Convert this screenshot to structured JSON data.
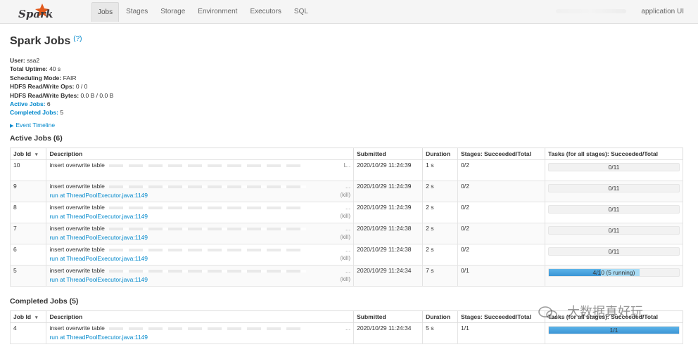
{
  "nav": {
    "tabs": [
      "Jobs",
      "Stages",
      "Storage",
      "Environment",
      "Executors",
      "SQL"
    ],
    "active_tab": "Jobs",
    "app_label": "application UI"
  },
  "page": {
    "title": "Spark Jobs",
    "help": "(?)"
  },
  "summary": {
    "user_label": "User:",
    "user": "ssa2",
    "uptime_label": "Total Uptime:",
    "uptime": "40 s",
    "mode_label": "Scheduling Mode:",
    "mode": "FAIR",
    "ops_label": "HDFS Read/Write Ops:",
    "ops": "0 / 0",
    "bytes_label": "HDFS Read/Write Bytes:",
    "bytes": "0.0 B / 0.0 B",
    "active_label": "Active Jobs:",
    "active": "6",
    "completed_label": "Completed Jobs:",
    "completed": "5"
  },
  "timeline": {
    "label": "Event Timeline"
  },
  "active_section": {
    "title": "Active Jobs (6)"
  },
  "completed_section": {
    "title": "Completed Jobs (5)"
  },
  "columns": [
    "Job Id",
    "Description",
    "Submitted",
    "Duration",
    "Stages: Succeeded/Total",
    "Tasks (for all stages): Succeeded/Total"
  ],
  "sort_indicator": "▾",
  "active_jobs": [
    {
      "id": "10",
      "desc": "insert overwrite table",
      "tail": "L..",
      "link": "",
      "kill": "",
      "submitted": "2020/10/29 11:24:39",
      "duration": "1 s",
      "stages": "0/2",
      "tasks": "0/11",
      "progress": 0,
      "running": 0
    },
    {
      "id": "9",
      "desc": "insert overwrite table",
      "tail": "...",
      "link": "run at ThreadPoolExecutor.java:1149",
      "kill": "(kill)",
      "submitted": "2020/10/29 11:24:39",
      "duration": "2 s",
      "stages": "0/2",
      "tasks": "0/11",
      "progress": 0,
      "running": 0
    },
    {
      "id": "8",
      "desc": "insert overwrite table",
      "tail": "...",
      "link": "run at ThreadPoolExecutor.java:1149",
      "kill": "(kill)",
      "submitted": "2020/10/29 11:24:39",
      "duration": "2 s",
      "stages": "0/2",
      "tasks": "0/11",
      "progress": 0,
      "running": 0
    },
    {
      "id": "7",
      "desc": "insert overwrite table",
      "tail": "...",
      "link": "run at ThreadPoolExecutor.java:1149",
      "kill": "(kill)",
      "submitted": "2020/10/29 11:24:38",
      "duration": "2 s",
      "stages": "0/2",
      "tasks": "0/11",
      "progress": 0,
      "running": 0
    },
    {
      "id": "6",
      "desc": "insert overwrite table",
      "tail": "...",
      "link": "run at ThreadPoolExecutor.java:1149",
      "kill": "(kill)",
      "submitted": "2020/10/29 11:24:38",
      "duration": "2 s",
      "stages": "0/2",
      "tasks": "0/11",
      "progress": 0,
      "running": 0
    },
    {
      "id": "5",
      "desc": "insert overwrite table",
      "tail": "...",
      "link": "run at ThreadPoolExecutor.java:1149",
      "kill": "(kill)",
      "submitted": "2020/10/29 11:24:34",
      "duration": "7 s",
      "stages": "0/1",
      "tasks": "4/10 (5 running)",
      "progress": 0.4,
      "running": 0.5
    }
  ],
  "completed_jobs": [
    {
      "id": "4",
      "desc": "insert overwrite table",
      "tail": "...",
      "link": "run at ThreadPoolExecutor.java:1149",
      "kill": "",
      "submitted": "2020/10/29 11:24:34",
      "duration": "5 s",
      "stages": "1/1",
      "tasks": "1/1",
      "progress": 1,
      "running": 0
    }
  ],
  "watermark": {
    "text": "大数据真好玩"
  },
  "colors": {
    "link": "#0088cc",
    "progress": "#3b95d6",
    "running": "#a9dcf5"
  }
}
